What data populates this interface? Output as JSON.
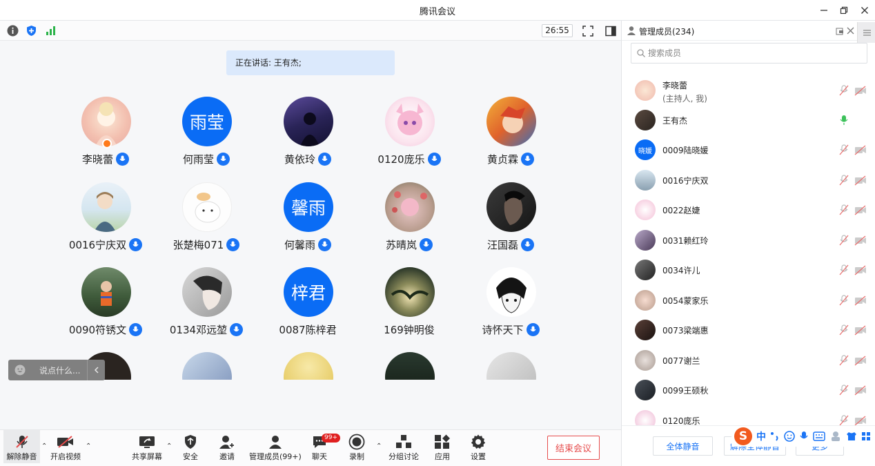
{
  "window": {
    "title": "腾讯会议"
  },
  "topbar": {
    "timer": "26:55"
  },
  "speaking": {
    "label": "正在讲话: 王有杰;"
  },
  "grid": {
    "participants": [
      {
        "name": "李晓蕾"
      },
      {
        "name": "何雨莹",
        "avatar_text": "雨莹"
      },
      {
        "name": "黄依玲"
      },
      {
        "name": "0120庞乐"
      },
      {
        "name": "黄贞霖"
      },
      {
        "name": "0016宁庆双"
      },
      {
        "name": "张楚梅071"
      },
      {
        "name": "何馨雨",
        "avatar_text": "馨雨"
      },
      {
        "name": "苏晴岚"
      },
      {
        "name": "汪国磊"
      },
      {
        "name": "0090符锈文"
      },
      {
        "name": "0134邓远堃"
      },
      {
        "name": "0087陈梓君",
        "avatar_text": "梓君"
      },
      {
        "name": "169钟明俊"
      },
      {
        "name": "诗怀天下"
      }
    ]
  },
  "chat": {
    "placeholder": "说点什么..."
  },
  "toolbar": {
    "unmute": "解除静音",
    "video": "开启视频",
    "share": "共享屏幕",
    "security": "安全",
    "invite": "邀请",
    "members": "管理成员(99+)",
    "chat": "聊天",
    "chat_badge": "99+",
    "record": "录制",
    "breakout": "分组讨论",
    "apps": "应用",
    "settings": "设置",
    "end": "结束会议"
  },
  "panel": {
    "title": "管理成员(234)",
    "search_placeholder": "搜索成员",
    "members": [
      {
        "name": "李晓蕾",
        "sub": "(主持人, 我)"
      },
      {
        "name": "王有杰"
      },
      {
        "name": "0009陆晓媛",
        "avatar_text": "晓媛"
      },
      {
        "name": "0016宁庆双"
      },
      {
        "name": "0022赵婕"
      },
      {
        "name": "0031赖红玲"
      },
      {
        "name": "0034许儿"
      },
      {
        "name": "0054蒙家乐"
      },
      {
        "name": "0073梁端惠"
      },
      {
        "name": "0077谢兰"
      },
      {
        "name": "0099王硕秋"
      },
      {
        "name": "0120庞乐"
      }
    ],
    "mute_all": "全体静音",
    "unmute_all": "解除全体静音",
    "more": "更多"
  },
  "ime": {
    "lang": "中"
  },
  "colors": {
    "accent": "#0a6cf5",
    "danger": "#e64b4b",
    "speaking_bg": "#dbe9fc"
  }
}
